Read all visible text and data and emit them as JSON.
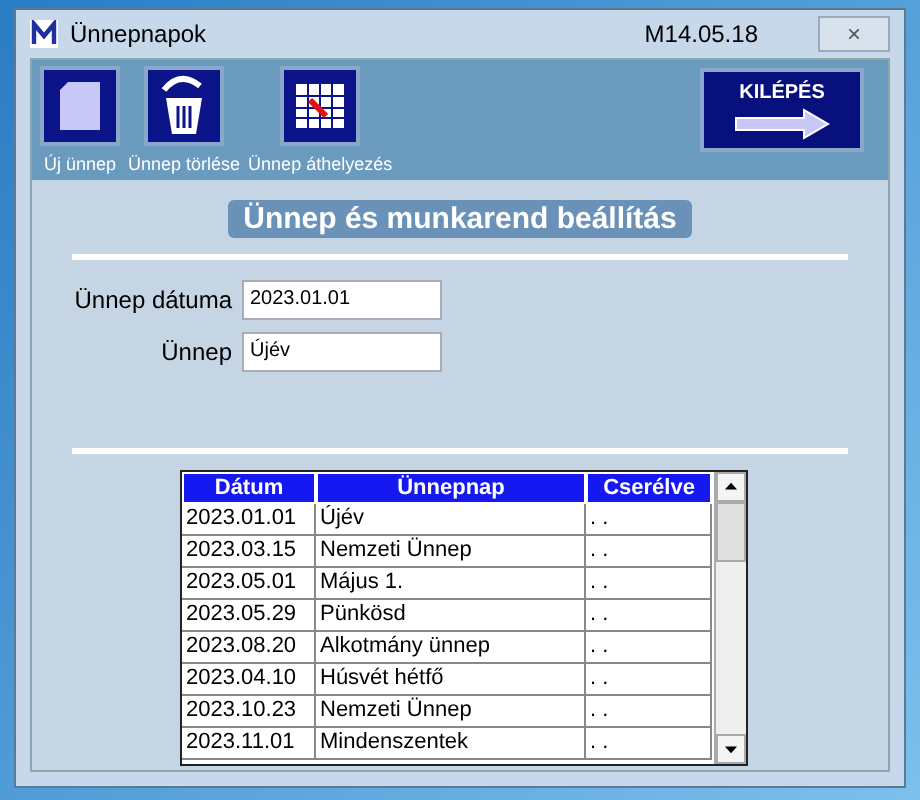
{
  "window": {
    "title": "Ünnepnapok",
    "version": "M14.05.18",
    "close": "×"
  },
  "toolbar": {
    "buttons": [
      {
        "kind": "new",
        "label": "Új ünnep"
      },
      {
        "kind": "delete",
        "label": "Ünnep törlése"
      },
      {
        "kind": "move",
        "label": "Ünnep áthelyezés"
      }
    ],
    "exit": "KILÉPÉS"
  },
  "heading": "Ünnep és munkarend beállítás",
  "form": [
    {
      "label": "Ünnep dátuma",
      "value": "2023.01.01"
    },
    {
      "label": "Ünnep",
      "value": "Újév"
    }
  ],
  "table": {
    "columns": [
      "Dátum",
      "Ünnepnap",
      "Cserélve"
    ],
    "rows": [
      [
        "2023.01.01",
        "Újév",
        ". ."
      ],
      [
        "2023.03.15",
        "Nemzeti Ünnep",
        ". ."
      ],
      [
        "2023.05.01",
        "Május 1.",
        ". ."
      ],
      [
        "2023.05.29",
        "Pünkösd",
        ". ."
      ],
      [
        "2023.08.20",
        "Alkotmány ünnep",
        ". ."
      ],
      [
        "2023.04.10",
        "Húsvét hétfő",
        ". ."
      ],
      [
        "2023.10.23",
        "Nemzeti Ünnep",
        ". ."
      ],
      [
        "2023.11.01",
        "Mindenszentek",
        ". ."
      ]
    ]
  }
}
